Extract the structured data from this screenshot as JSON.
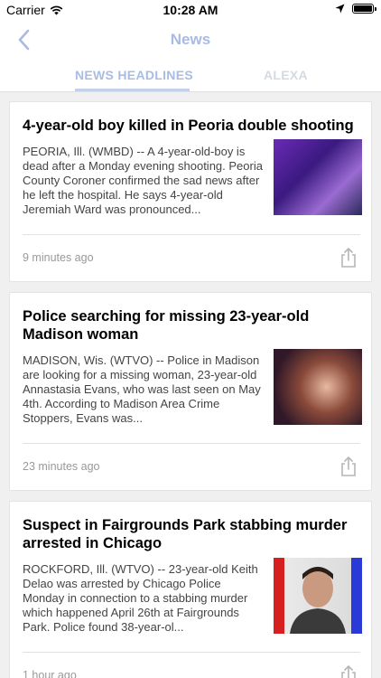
{
  "status_bar": {
    "carrier": "Carrier",
    "time": "10:28 AM"
  },
  "nav": {
    "title": "News"
  },
  "tabs": [
    {
      "label": "NEWS HEADLINES",
      "selected": true
    },
    {
      "label": "ALEXA",
      "selected": false
    }
  ],
  "articles": [
    {
      "title": "4-year-old boy killed in Peoria double shooting",
      "body": "PEORIA, Ill. (WMBD) -- A 4-year-old-boy is dead after a Monday evening shooting. Peoria County Coroner confirmed the sad news after he left the hospital. He says 4-year-old Jeremiah Ward was pronounced...",
      "time": "9 minutes ago"
    },
    {
      "title": "Police searching for missing 23-year-old Madison woman",
      "body": "MADISON, Wis. (WTVO) -- Police in Madison are looking for a missing woman, 23-year-old Annastasia Evans, who was last seen on May 4th. According to Madison Area Crime Stoppers, Evans was...",
      "time": "23 minutes ago"
    },
    {
      "title": "Suspect in Fairgrounds Park stabbing murder arrested in Chicago",
      "body": "ROCKFORD, Ill. (WTVO) -- 23-year-old Keith Delao was arrested by Chicago Police Monday in connection to a stabbing murder which happened April 26th at Fairgrounds Park. Police found 38-year-ol...",
      "time": "1 hour ago"
    }
  ],
  "colors": {
    "accent": "#a9bbe3",
    "tab_inactive": "#d4d9e2",
    "background": "#f0f0f0"
  },
  "icons": {
    "back": "chevron-left-icon",
    "share": "share-icon",
    "wifi": "wifi-icon",
    "location": "location-arrow-icon",
    "battery": "battery-icon"
  }
}
